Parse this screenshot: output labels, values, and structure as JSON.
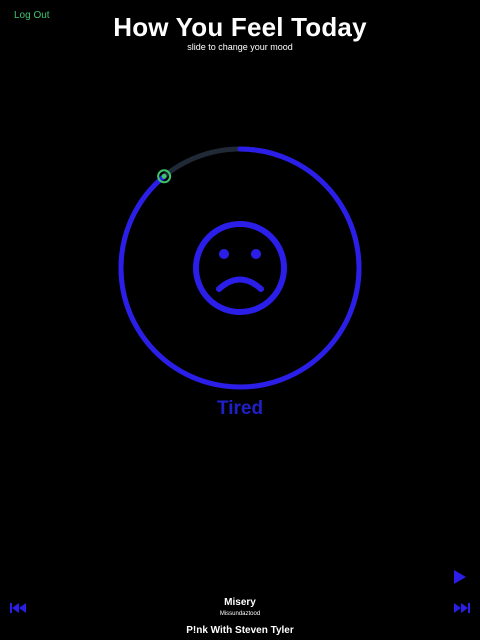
{
  "header": {
    "logout_label": "Log Out",
    "title": "How You Feel Today",
    "subtitle": "slide to change your mood"
  },
  "mood": {
    "label": "Tired",
    "face_icon": "sad-face-icon",
    "slider_level_percent": 89,
    "colors": {
      "accent": "#2a1ee8",
      "track_inactive": "#1f2a36",
      "handle": "#3ec46d",
      "label": "#2020c8"
    }
  },
  "player": {
    "song_title": "Misery",
    "album": "Missundaztood",
    "artist": "P!nk With Steven Tyler",
    "icons": {
      "play": "play-icon",
      "previous": "skip-previous-icon",
      "next": "skip-next-icon"
    }
  }
}
